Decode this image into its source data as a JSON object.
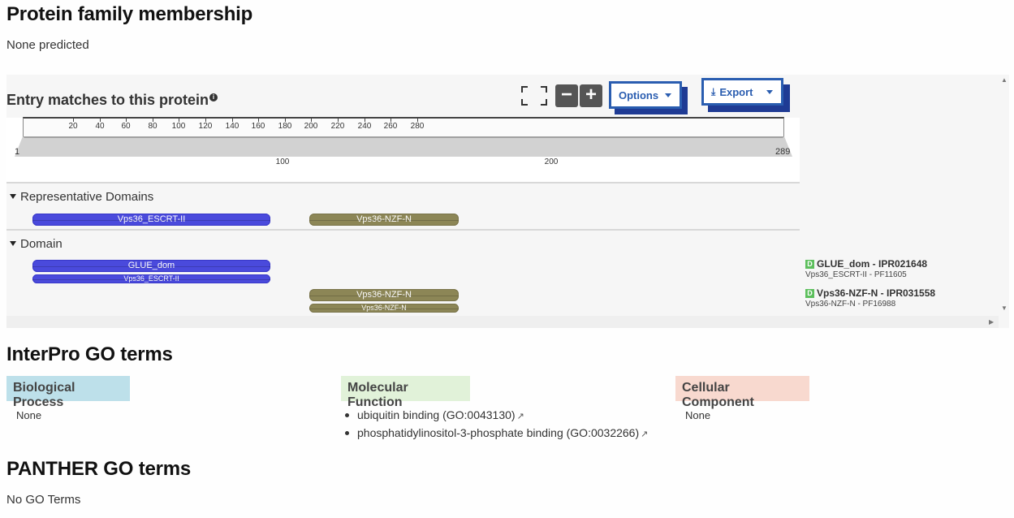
{
  "family": {
    "title": "Protein family membership",
    "text": "None predicted"
  },
  "entry_matches": {
    "title": "Entry matches to this protein",
    "info_icon": "info-icon",
    "fullscreen_icon": "fullscreen-icon",
    "zoom_out": "−",
    "zoom_in": "+",
    "options_label": "Options",
    "export_label": "Export",
    "export_icon": "⤓",
    "ruler": {
      "ticks": [
        "20",
        "40",
        "60",
        "80",
        "100",
        "120",
        "140",
        "160",
        "180",
        "200",
        "220",
        "240",
        "260",
        "280"
      ],
      "start": "1",
      "end": "289",
      "bottom_labels": [
        "100",
        "200"
      ]
    },
    "sections": [
      {
        "label": "Representative Domains",
        "tracks": [
          {
            "name": "Vps36_ESCRT-II",
            "color": "blue"
          },
          {
            "name": "Vps36-NZF-N",
            "color": "olive"
          }
        ]
      },
      {
        "label": "Domain",
        "tracks": [
          {
            "name": "GLUE_dom",
            "sub": "Vps36_ESCRT-II",
            "color": "blue"
          },
          {
            "name": "Vps36-NZF-N",
            "sub": "Vps36-NZF-N",
            "color": "olive"
          }
        ]
      }
    ],
    "legend": [
      {
        "badge": "D",
        "name": "GLUE_dom - IPR021648",
        "sub": "Vps36_ESCRT-II - PF11605"
      },
      {
        "badge": "D",
        "name": "Vps36-NZF-N - IPR031558",
        "sub": "Vps36-NZF-N - PF16988"
      }
    ],
    "colors": {
      "blue": "#4a4adc",
      "olive": "#8c8656",
      "accent": "#2a5db0"
    }
  },
  "interpro_go": {
    "title": "InterPro GO terms",
    "columns": [
      {
        "header": "Biological Process",
        "color": "#bde0ea",
        "items": [],
        "none": "None"
      },
      {
        "header": "Molecular Function",
        "color": "#e1f2d9",
        "items": [
          "ubiquitin binding (GO:0043130)",
          "phosphatidylinositol-3-phosphate binding (GO:0032266)"
        ]
      },
      {
        "header": "Cellular Component",
        "color": "#f8d9cf",
        "items": [],
        "none": "None"
      }
    ],
    "external_icon": "↗"
  },
  "panther_go": {
    "title": "PANTHER GO terms",
    "text": "No GO Terms"
  }
}
